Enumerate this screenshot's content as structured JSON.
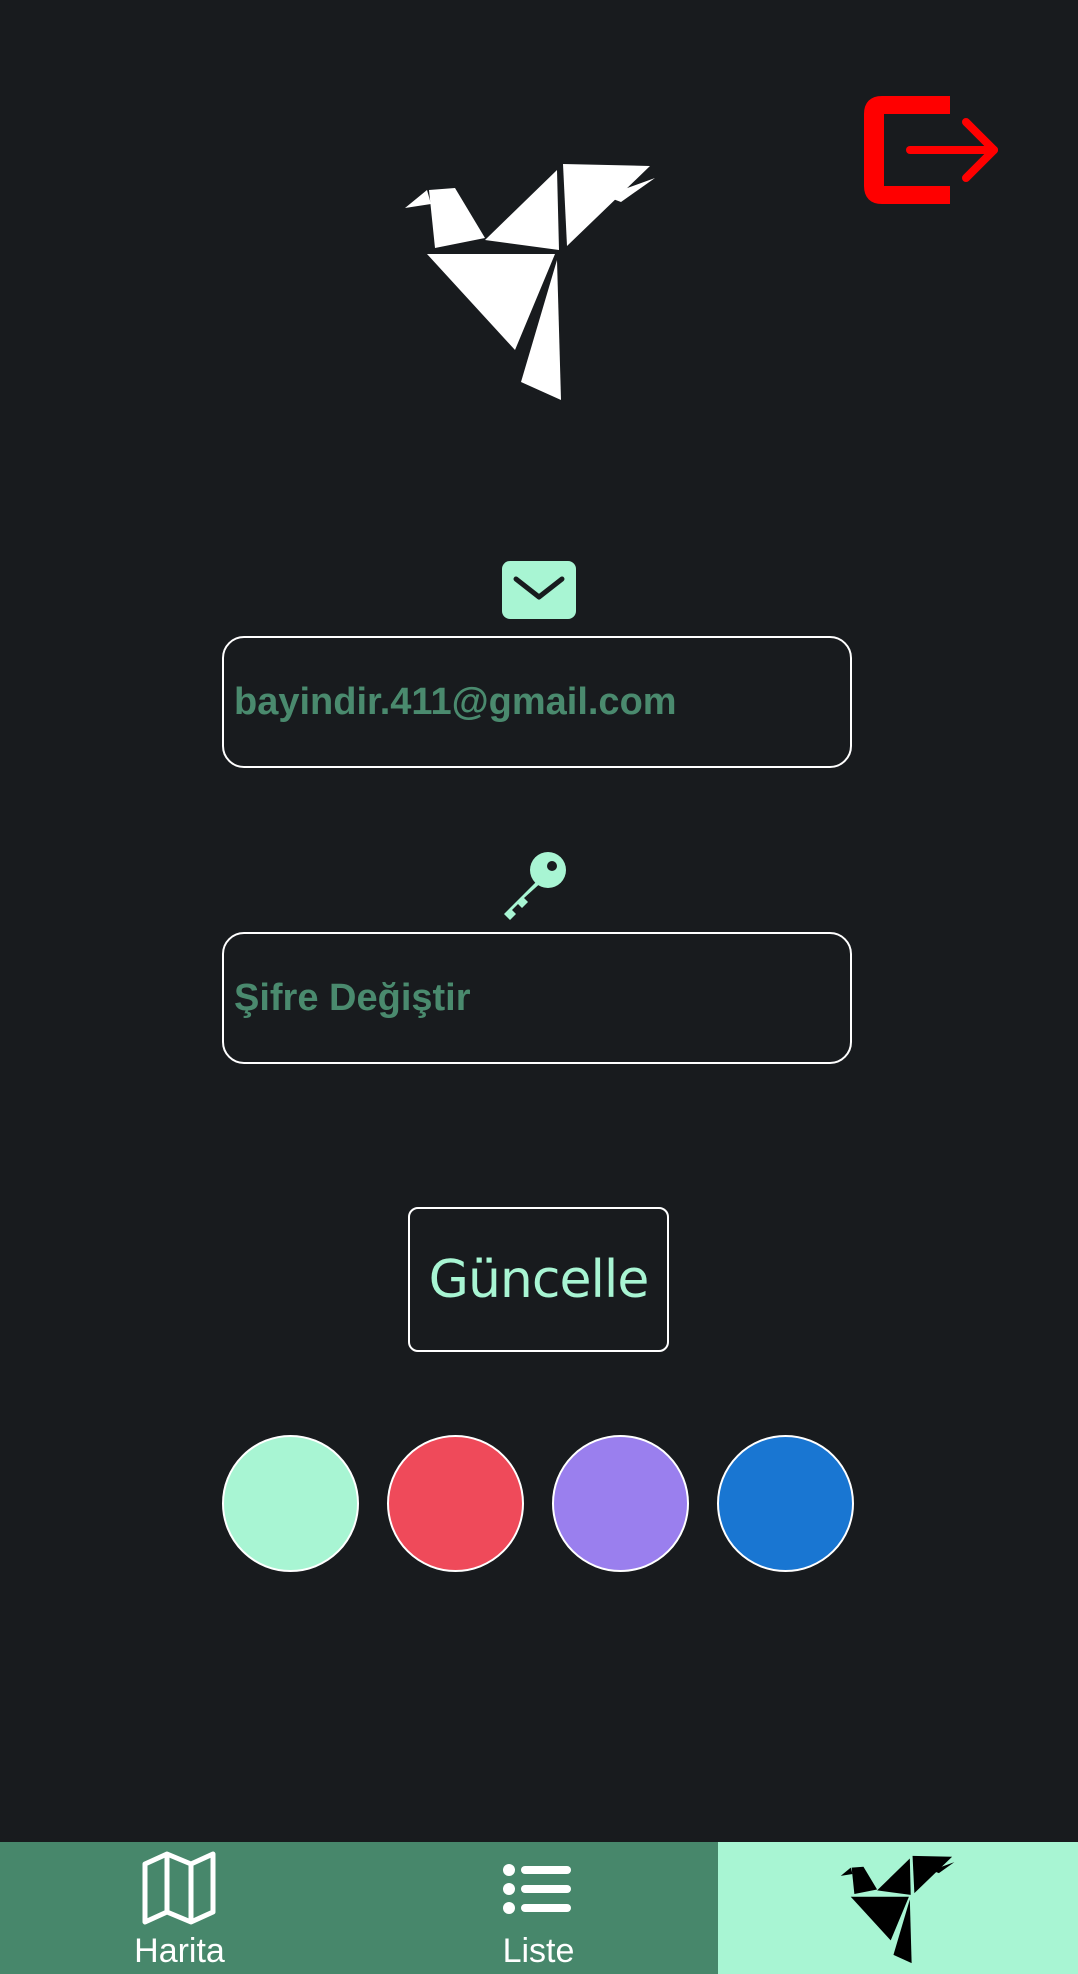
{
  "header": {
    "logout_icon": "logout-icon",
    "logout_color": "#ff0000",
    "logo_icon": "origami-bird-logo"
  },
  "form": {
    "email": {
      "icon": "envelope-icon",
      "value": "bayindir.411@gmail.com",
      "placeholder": ""
    },
    "password": {
      "icon": "key-icon",
      "value": "",
      "placeholder": "Şifre Değiştir"
    },
    "update_label": "Güncelle"
  },
  "theme_swatches": [
    {
      "color": "#a8f5d3"
    },
    {
      "color": "#ef4a5a"
    },
    {
      "color": "#9a7fee"
    },
    {
      "color": "#1976d2"
    }
  ],
  "bottom_nav": {
    "items": [
      {
        "label": "Harita",
        "icon": "map-icon"
      },
      {
        "label": "Liste",
        "icon": "list-icon"
      },
      {
        "label": "",
        "icon": "origami-bird-icon",
        "active": true
      }
    ],
    "background": "#47876b",
    "active_background": "#a8f5d3"
  },
  "colors": {
    "background": "#181b1e",
    "accent": "#a8f5d3",
    "field_text": "#4a8a6e"
  }
}
